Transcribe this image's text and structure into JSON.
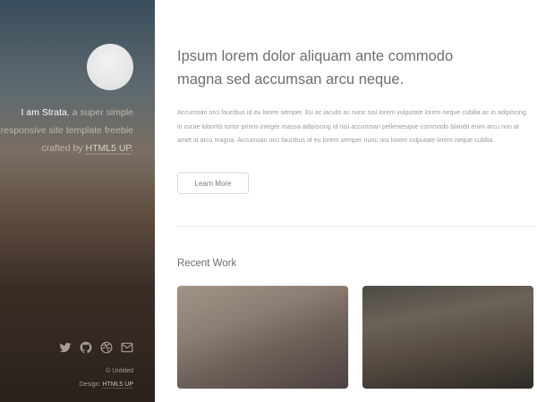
{
  "sidebar": {
    "intro_name": "I am Strata",
    "intro_text": ", a super simple responsive site template freebie crafted by ",
    "intro_link": "HTML5 UP",
    "intro_end": ".",
    "social_icons": [
      "twitter-icon",
      "github-icon",
      "dribbble-icon",
      "envelope-icon"
    ],
    "copyright": "© Untitled",
    "design_prefix": "Design: ",
    "design_link": "HTML5 UP"
  },
  "main": {
    "headline_line1": "Ipsum lorem dolor aliquam ante commodo",
    "headline_line2": "magna sed accumsan arcu neque.",
    "lede": "Accumsan orci faucibus id eu lorem semper. Eu ac iaculis ac nunc nisi lorem vulputate lorem neque cubilia ac in adipiscing in curae lobortis tortor primis integer massa adipiscing id nisi accumsan pellentesque commodo blandit enim arcu non at amet id arcu magna. Accumsan orci faucibus id eu lorem semper nunc nisi lorem vulputate lorem neque cubilia.",
    "learn_more": "Learn More",
    "recent_work_title": "Recent Work"
  },
  "colors": {
    "avatar": "#e6e6e6",
    "sidebar_top": "#3a4d5c",
    "sidebar_bottom": "#2a211c",
    "icon": "#a79e97"
  }
}
